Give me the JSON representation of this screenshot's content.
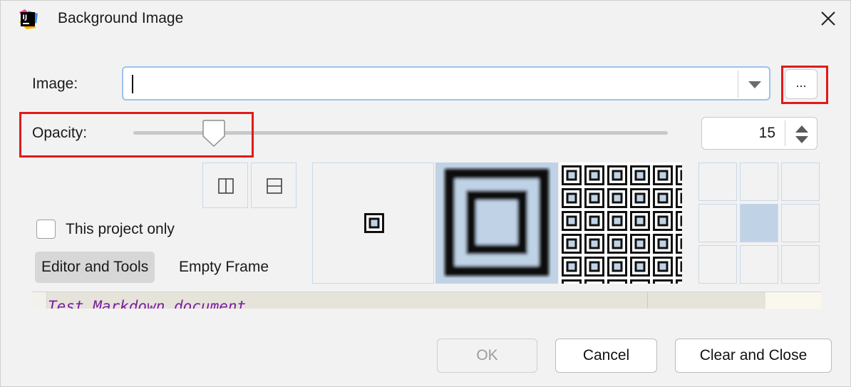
{
  "window": {
    "title": "Background Image",
    "app_icon": "intellij-idea-icon",
    "app_icon_text": "IJ",
    "close_icon": "close-icon"
  },
  "image_field": {
    "label": "Image:",
    "value": "",
    "browse_label": "..."
  },
  "opacity": {
    "label": "Opacity:",
    "value": "15",
    "slider_fraction": 0.15
  },
  "flip_buttons": [
    {
      "name": "flip-horizontal-icon"
    },
    {
      "name": "flip-vertical-icon"
    }
  ],
  "fill_options": [
    {
      "name": "fill-center",
      "selected": false
    },
    {
      "name": "fill-scale",
      "selected": true
    },
    {
      "name": "fill-tile",
      "selected": false
    }
  ],
  "anchor_grid": {
    "selected_index": 4
  },
  "project_only": {
    "label": "This project only",
    "checked": false
  },
  "tabs": [
    {
      "label": "Editor and Tools",
      "active": true
    },
    {
      "label": "Empty Frame",
      "active": false
    }
  ],
  "preview": {
    "text": "Test Markdown document"
  },
  "buttons": {
    "ok": "OK",
    "cancel": "Cancel",
    "clear_close": "Clear and Close"
  },
  "colors": {
    "highlight": "#e21a1a",
    "accent_border": "#9cc2ee",
    "selection_fill": "#c0d3e6",
    "preview_text": "#7a1f9e"
  }
}
